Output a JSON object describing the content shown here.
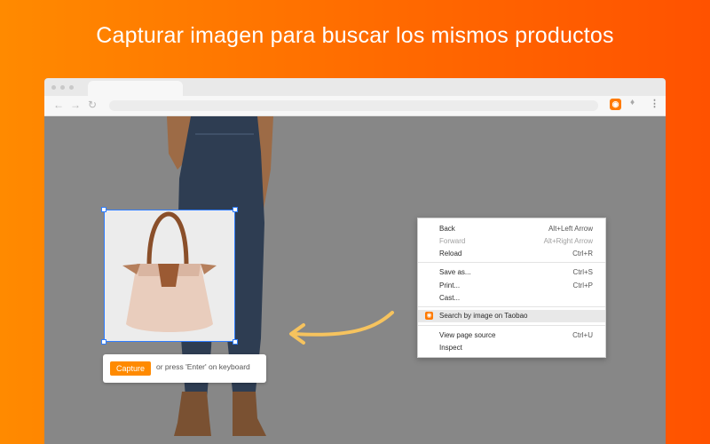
{
  "headline": "Capturar imagen para buscar los mismos productos",
  "extensions": {
    "taobao_icon": "taobao-search-icon",
    "puzzle_icon": "puzzle-icon",
    "menu_icon": "vertical-dots-icon"
  },
  "capture": {
    "button_label": "Capture",
    "hint": "or press 'Enter' on keyboard"
  },
  "context_menu": {
    "back": {
      "label": "Back",
      "shortcut": "Alt+Left Arrow"
    },
    "forward": {
      "label": "Forward",
      "shortcut": "Alt+Right Arrow"
    },
    "reload": {
      "label": "Reload",
      "shortcut": "Ctrl+R"
    },
    "save_as": {
      "label": "Save as...",
      "shortcut": "Ctrl+S"
    },
    "print": {
      "label": "Print...",
      "shortcut": "Ctrl+P"
    },
    "cast": {
      "label": "Cast..."
    },
    "search_by_image": {
      "label": "Search by image on Taobao"
    },
    "view_source": {
      "label": "View page source",
      "shortcut": "Ctrl+U"
    },
    "inspect": {
      "label": "Inspect"
    }
  },
  "colors": {
    "accent": "#ff8a00",
    "selection": "#2f7dff",
    "arrow": "#f6c35e",
    "page_bg": "#878787"
  }
}
